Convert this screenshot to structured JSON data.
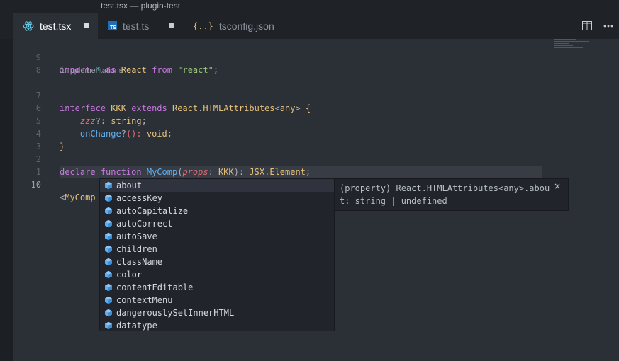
{
  "window": {
    "title": "test.tsx — plugin-test"
  },
  "tabs": [
    {
      "label": "test.tsx",
      "icon": "react-icon",
      "active": true,
      "dirty": true
    },
    {
      "label": "test.ts",
      "icon": "typescript-file-icon",
      "active": false,
      "dirty": true
    },
    {
      "label": "tsconfig.json",
      "icon": "json-braces-icon",
      "active": false,
      "dirty": false
    }
  ],
  "editor": {
    "line_numbers": [
      "9",
      "8",
      "7",
      "6",
      "5",
      "4",
      "3",
      "2",
      "1",
      "10"
    ],
    "codelens": "0 implementations",
    "code": {
      "l9": {
        "kw_import": "import",
        "star": "*",
        "kw_as": "as",
        "ident": "React",
        "kw_from": "from",
        "str": "\"react\"",
        "semi": ";"
      },
      "l7": {
        "kw_interface": "interface",
        "name": "KKK",
        "kw_extends": "extends",
        "base": "React",
        "dot": ".",
        "type": "HTMLAttributes",
        "lt": "<",
        "arg": "any",
        "gt": ">",
        "brace": "{"
      },
      "l6": {
        "prop": "zzz",
        "opt": "?:",
        "type": "string",
        "semi": ";"
      },
      "l5": {
        "prop": "onChange",
        "opt": "?",
        "paren": "():",
        "type": "void",
        "semi": ";"
      },
      "l4": {
        "brace": "}"
      },
      "l2": {
        "kw_declare": "declare",
        "kw_function": "function",
        "name": "MyComp",
        "open": "(",
        "param": "props",
        "colon": ":",
        "ptype": "KKK",
        "close": "):",
        "rtype": "JSX",
        "dot": ".",
        "rtype2": "Element",
        "semi": ";"
      },
      "l10": {
        "open": "<",
        "tag": "MyComp",
        "close": "/>"
      }
    }
  },
  "suggestions": {
    "items": [
      "about",
      "accessKey",
      "autoCapitalize",
      "autoCorrect",
      "autoSave",
      "children",
      "className",
      "color",
      "contentEditable",
      "contextMenu",
      "dangerouslySetInnerHTML",
      "datatype"
    ],
    "selected_index": 0,
    "item_icon": "property-cube-icon"
  },
  "details": {
    "line1": "(property) React.HTMLAttributes<any>.abou",
    "line2": "t: string | undefined",
    "close_label": "×"
  },
  "colors": {
    "background": "#2b2f36",
    "keyword": "#c678dd",
    "string": "#98c379",
    "class": "#e5c07b",
    "function": "#61afef",
    "property": "#e06c75",
    "icon_blue": "#61afef"
  }
}
